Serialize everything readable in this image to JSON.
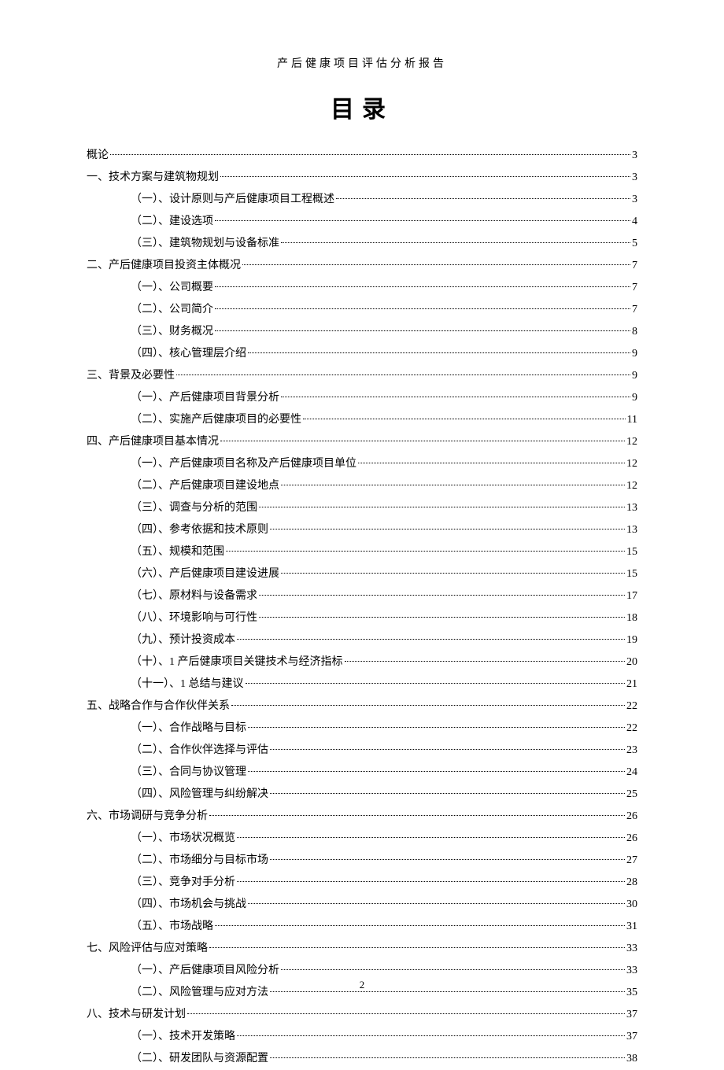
{
  "header": "产后健康项目评估分析报告",
  "title": "目录",
  "footer_page": "2",
  "toc": [
    {
      "level": 1,
      "label": "概论",
      "page": "3",
      "trail": false
    },
    {
      "level": 1,
      "label": "一、技术方案与建筑物规划",
      "page": "3",
      "trail": false
    },
    {
      "level": 2,
      "label": "（一）、设计原则与产后健康项目工程概述",
      "page": "3",
      "trail": false
    },
    {
      "level": 2,
      "label": "（二）、建设选项",
      "page": "4",
      "trail": false
    },
    {
      "level": 2,
      "label": "（三）、建筑物规划与设备标准",
      "page": "5",
      "trail": false
    },
    {
      "level": 1,
      "label": "二、产后健康项目投资主体概况",
      "page": "7",
      "trail": false
    },
    {
      "level": 2,
      "label": "（一）、公司概要",
      "page": "7",
      "trail": false
    },
    {
      "level": 2,
      "label": "（二）、公司简介",
      "page": "7",
      "trail": false
    },
    {
      "level": 2,
      "label": "（三）、财务概况",
      "page": "8",
      "trail": false
    },
    {
      "level": 2,
      "label": "（四）、核心管理层介绍",
      "page": "9",
      "trail": false
    },
    {
      "level": 1,
      "label": "三、背景及必要性",
      "page": "9",
      "trail": true
    },
    {
      "level": 2,
      "label": "（一）、产后健康项目背景分析",
      "page": "9",
      "trail": false
    },
    {
      "level": 2,
      "label": "（二）、实施产后健康项目的必要性",
      "page": "11",
      "trail": false
    },
    {
      "level": 1,
      "label": "四、产后健康项目基本情况",
      "page": "12",
      "trail": false
    },
    {
      "level": 2,
      "label": "（一）、产后健康项目名称及产后健康项目单位",
      "page": "12",
      "trail": false
    },
    {
      "level": 2,
      "label": "（二）、产后健康项目建设地点",
      "page": "12",
      "trail": false
    },
    {
      "level": 2,
      "label": "（三）、调查与分析的范围",
      "page": "13",
      "trail": false
    },
    {
      "level": 2,
      "label": "（四）、参考依据和技术原则",
      "page": "13",
      "trail": false
    },
    {
      "level": 2,
      "label": "（五）、规模和范围",
      "page": "15",
      "trail": false
    },
    {
      "level": 2,
      "label": "（六）、产后健康项目建设进展",
      "page": "15",
      "trail": false
    },
    {
      "level": 2,
      "label": "（七）、原材料与设备需求",
      "page": "17",
      "trail": false
    },
    {
      "level": 2,
      "label": "（八）、环境影响与可行性",
      "page": "18",
      "trail": false
    },
    {
      "level": 2,
      "label": "（九）、预计投资成本",
      "page": "19",
      "trail": false
    },
    {
      "level": 2,
      "label": "（十）、1 产后健康项目关键技术与经济指标",
      "page": "20",
      "trail": false
    },
    {
      "level": 2,
      "label": "（十一）、1 总结与建议",
      "page": "21",
      "trail": false
    },
    {
      "level": 1,
      "label": "五、战略合作与合作伙伴关系",
      "page": "22",
      "trail": false
    },
    {
      "level": 2,
      "label": "（一）、合作战略与目标",
      "page": "22",
      "trail": false
    },
    {
      "level": 2,
      "label": "（二）、合作伙伴选择与评估",
      "page": "23",
      "trail": false
    },
    {
      "level": 2,
      "label": "（三）、合同与协议管理",
      "page": "24",
      "trail": false
    },
    {
      "level": 2,
      "label": "（四）、风险管理与纠纷解决",
      "page": "25",
      "trail": false
    },
    {
      "level": 1,
      "label": "六、市场调研与竞争分析",
      "page": "26",
      "trail": false
    },
    {
      "level": 2,
      "label": "（一）、市场状况概览",
      "page": "26",
      "trail": false
    },
    {
      "level": 2,
      "label": "（二）、市场细分与目标市场",
      "page": "27",
      "trail": false
    },
    {
      "level": 2,
      "label": "（三）、竞争对手分析",
      "page": "28",
      "trail": false
    },
    {
      "level": 2,
      "label": "（四）、市场机会与挑战",
      "page": "30",
      "trail": false
    },
    {
      "level": 2,
      "label": "（五）、市场战略",
      "page": "31",
      "trail": true
    },
    {
      "level": 1,
      "label": "七、风险评估与应对策略",
      "page": "33",
      "trail": false
    },
    {
      "level": 2,
      "label": "（一）、产后健康项目风险分析",
      "page": "33",
      "trail": false
    },
    {
      "level": 2,
      "label": "（二）、风险管理与应对方法",
      "page": "35",
      "trail": false
    },
    {
      "level": 1,
      "label": "八、技术与研发计划",
      "page": "37",
      "trail": true
    },
    {
      "level": 2,
      "label": "（一）、技术开发策略",
      "page": "37",
      "trail": false
    },
    {
      "level": 2,
      "label": "（二）、研发团队与资源配置",
      "page": "38",
      "trail": false
    }
  ]
}
